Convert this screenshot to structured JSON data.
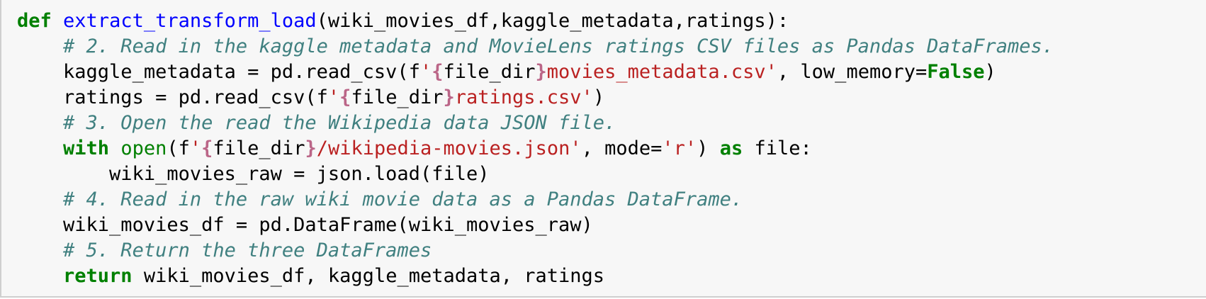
{
  "cell": {
    "lines": [
      {
        "indent": "",
        "tokens": [
          {
            "t": "def",
            "c": "kw"
          },
          {
            "t": " ",
            "c": ""
          },
          {
            "t": "extract_transform_load",
            "c": "fn"
          },
          {
            "t": "(wiki_movies_df,kaggle_metadata,ratings):",
            "c": ""
          }
        ]
      },
      {
        "indent": "    ",
        "tokens": [
          {
            "t": "# 2. Read in the kaggle metadata and MovieLens ratings CSV files as Pandas DataFrames.",
            "c": "cm"
          }
        ]
      },
      {
        "indent": "    ",
        "tokens": [
          {
            "t": "kaggle_metadata = pd.read_csv(f",
            "c": ""
          },
          {
            "t": "'",
            "c": "st"
          },
          {
            "t": "{",
            "c": "si"
          },
          {
            "t": "file_dir",
            "c": ""
          },
          {
            "t": "}",
            "c": "si"
          },
          {
            "t": "movies_metadata.csv'",
            "c": "st"
          },
          {
            "t": ", low_memory=",
            "c": ""
          },
          {
            "t": "False",
            "c": "kw"
          },
          {
            "t": ")",
            "c": ""
          }
        ]
      },
      {
        "indent": "    ",
        "tokens": [
          {
            "t": "ratings = pd.read_csv(f",
            "c": ""
          },
          {
            "t": "'",
            "c": "st"
          },
          {
            "t": "{",
            "c": "si"
          },
          {
            "t": "file_dir",
            "c": ""
          },
          {
            "t": "}",
            "c": "si"
          },
          {
            "t": "ratings.csv'",
            "c": "st"
          },
          {
            "t": ")",
            "c": ""
          }
        ]
      },
      {
        "indent": "    ",
        "tokens": [
          {
            "t": "# 3. Open the read the Wikipedia data JSON file.",
            "c": "cm"
          }
        ]
      },
      {
        "indent": "    ",
        "tokens": [
          {
            "t": "with",
            "c": "kw"
          },
          {
            "t": " ",
            "c": ""
          },
          {
            "t": "open",
            "c": "bi"
          },
          {
            "t": "(f",
            "c": ""
          },
          {
            "t": "'",
            "c": "st"
          },
          {
            "t": "{",
            "c": "si"
          },
          {
            "t": "file_dir",
            "c": ""
          },
          {
            "t": "}",
            "c": "si"
          },
          {
            "t": "/wikipedia-movies.json'",
            "c": "st"
          },
          {
            "t": ", mode=",
            "c": ""
          },
          {
            "t": "'r'",
            "c": "st"
          },
          {
            "t": ") ",
            "c": ""
          },
          {
            "t": "as",
            "c": "kw"
          },
          {
            "t": " file:",
            "c": ""
          }
        ]
      },
      {
        "indent": "        ",
        "tokens": [
          {
            "t": "wiki_movies_raw = json.load(file)",
            "c": ""
          }
        ]
      },
      {
        "indent": "    ",
        "tokens": [
          {
            "t": "# 4. Read in the raw wiki movie data as a Pandas DataFrame.",
            "c": "cm"
          }
        ]
      },
      {
        "indent": "    ",
        "tokens": [
          {
            "t": "wiki_movies_df = pd.DataFrame(wiki_movies_raw)",
            "c": ""
          }
        ]
      },
      {
        "indent": "    ",
        "tokens": [
          {
            "t": "# 5. Return the three DataFrames",
            "c": "cm"
          }
        ]
      },
      {
        "indent": "    ",
        "tokens": [
          {
            "t": "return",
            "c": "kw"
          },
          {
            "t": " wiki_movies_df, kaggle_metadata, ratings",
            "c": ""
          }
        ]
      }
    ]
  }
}
